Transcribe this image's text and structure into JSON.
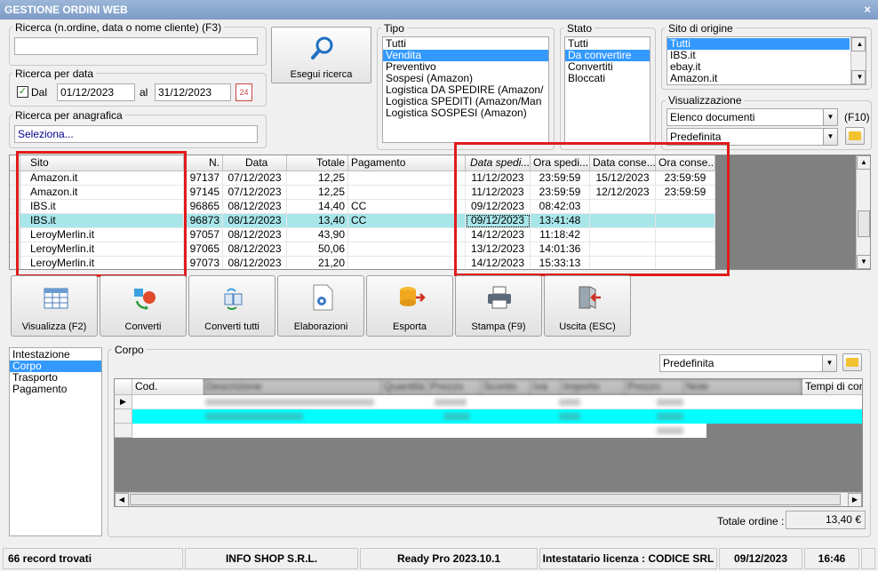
{
  "window": {
    "title": "GESTIONE ORDINI WEB",
    "close_glyph": "×"
  },
  "search": {
    "label": "Ricerca (n.ordine, data o nome cliente) (F3)",
    "value": "",
    "button": "Esegui ricerca"
  },
  "date_search": {
    "label": "Ricerca per data",
    "dal_label": "Dal",
    "dal_checked": true,
    "from": "01/12/2023",
    "al_label": "al",
    "to": "31/12/2023"
  },
  "registry_search": {
    "label": "Ricerca per anagrafica",
    "value": "Seleziona..."
  },
  "tipo": {
    "label": "Tipo",
    "items": [
      "Tutti",
      "Vendita",
      "Preventivo",
      "Sospesi (Amazon)",
      "Logistica DA SPEDIRE (Amazon/",
      "Logistica SPEDITI (Amazon/Man",
      "Logistica SOSPESI (Amazon)"
    ],
    "selected": 1
  },
  "stato": {
    "label": "Stato",
    "items": [
      "Tutti",
      "Da convertire",
      "Convertiti",
      "Bloccati"
    ],
    "selected": 1
  },
  "sito": {
    "label": "Sito di origine",
    "items": [
      "Tutti",
      "IBS.it",
      "ebay.it",
      "Amazon.it"
    ],
    "selected": 0
  },
  "visualizzazione": {
    "label": "Visualizzazione",
    "documents": "Elenco documenti",
    "shortcut": "(F10)",
    "layout": "Predefinita"
  },
  "orders": {
    "headers": [
      "Sito",
      "N.",
      "Data",
      "Totale",
      "Pagamento",
      "Data spedi...",
      "Ora spedi...",
      "Data conse...",
      "Ora conse..."
    ],
    "rows": [
      [
        "Amazon.it",
        "97137",
        "07/12/2023",
        "12,25",
        "",
        "11/12/2023",
        "23:59:59",
        "15/12/2023",
        "23:59:59"
      ],
      [
        "Amazon.it",
        "97145",
        "07/12/2023",
        "12,25",
        "",
        "11/12/2023",
        "23:59:59",
        "12/12/2023",
        "23:59:59"
      ],
      [
        "IBS.it",
        "96865",
        "08/12/2023",
        "14,40",
        "CC",
        "09/12/2023",
        "08:42:03",
        "",
        ""
      ],
      [
        "IBS.it",
        "96873",
        "08/12/2023",
        "13,40",
        "CC",
        "09/12/2023",
        "13:41:48",
        "",
        ""
      ],
      [
        "LeroyMerlin.it",
        "97057",
        "08/12/2023",
        "43,90",
        "",
        "14/12/2023",
        "11:18:42",
        "",
        ""
      ],
      [
        "LeroyMerlin.it",
        "97065",
        "08/12/2023",
        "50,06",
        "",
        "13/12/2023",
        "14:01:36",
        "",
        ""
      ],
      [
        "LeroyMerlin.it",
        "97073",
        "08/12/2023",
        "21,20",
        "",
        "14/12/2023",
        "15:33:13",
        "",
        ""
      ]
    ],
    "selected_row": 3
  },
  "toolbar": {
    "visualizza": "Visualizza (F2)",
    "converti": "Converti",
    "converti_tutti": "Converti tutti",
    "elaborazioni": "Elaborazioni",
    "esporta": "Esporta",
    "stampa": "Stampa (F9)",
    "uscita": "Uscita (ESC)"
  },
  "sections": {
    "items": [
      "Intestazione",
      "Corpo",
      "Trasporto",
      "Pagamento"
    ],
    "selected": 1
  },
  "corpo": {
    "label": "Corpo",
    "layout": "Predefinita",
    "headers": [
      "Cod.",
      "Descrizione",
      "Quantità",
      "Prezzo",
      "Sconto",
      "Iva",
      "Importo",
      "Prezzo",
      "Note",
      "Tempi di consegna"
    ],
    "total_label": "Totale ordine :",
    "total_value": "13,40 €"
  },
  "statusbar": {
    "records": "66 record trovati",
    "company": "INFO SHOP S.R.L.",
    "version": "Ready Pro 2023.10.1",
    "license": "Intestatario licenza : CODICE SRL",
    "date": "09/12/2023",
    "time": "16:46"
  },
  "colors": {
    "title_bar": "#7d9cc6",
    "selection": "#3399ff",
    "row_highlight": "#a8e6ea",
    "body_highlight": "#00ffff",
    "annotation": "#e01b1b"
  }
}
